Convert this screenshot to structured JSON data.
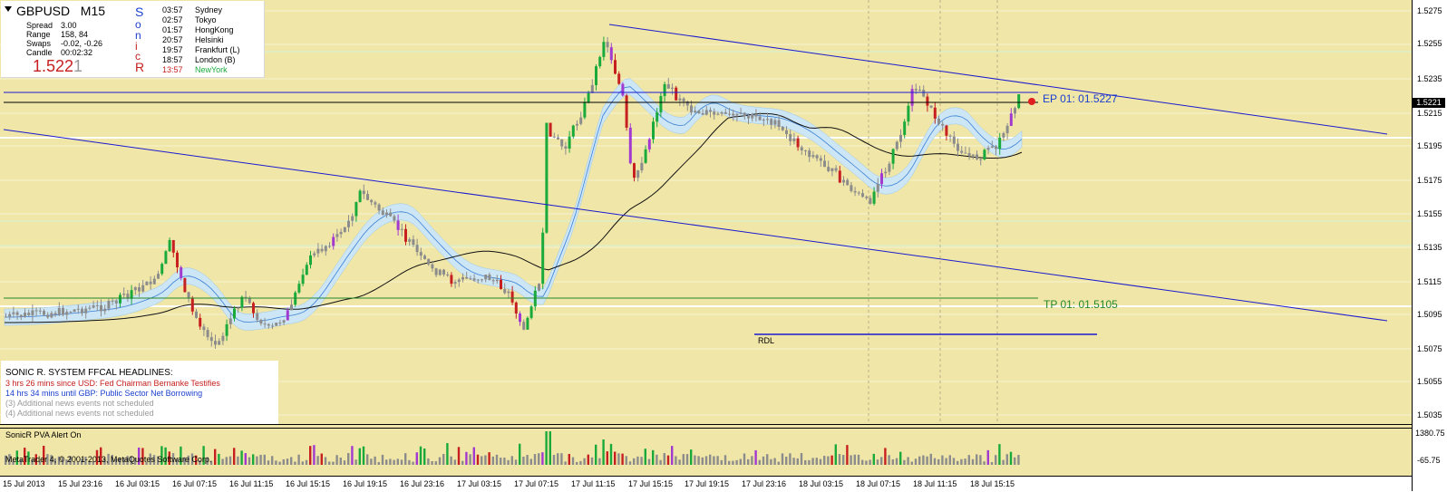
{
  "symbol": {
    "name": "GBPUSD",
    "timeframe": "M15"
  },
  "info": [
    {
      "label": "Spread",
      "value": "3.00"
    },
    {
      "label": "Range",
      "value": "158, 84"
    },
    {
      "label": "Swaps",
      "value": "-0.02, -0.26"
    },
    {
      "label": "Candle",
      "value": "00:02:32"
    }
  ],
  "price_big": {
    "main": "1.522",
    "last": "1"
  },
  "sonic_letters": [
    "S",
    "o",
    "n",
    "i",
    "c",
    "R"
  ],
  "sessions": [
    {
      "time": "03:57",
      "name": "Sydney"
    },
    {
      "time": "02:57",
      "name": "Tokyo"
    },
    {
      "time": "01:57",
      "name": "HongKong"
    },
    {
      "time": "20:57",
      "name": "Helsinki"
    },
    {
      "time": "19:57",
      "name": "Frankfurt  (L)"
    },
    {
      "time": "18:57",
      "name": "London  (B)"
    },
    {
      "time": "13:57",
      "name": "NewYork"
    }
  ],
  "news": {
    "title": "SONIC R. SYSTEM  FFCAL HEADLINES:",
    "lines": [
      "3 hrs 26 mins since USD: Fed Chairman Bernanke Testifies",
      "14 hrs 34 mins until GBP: Public Sector Net Borrowing",
      "(3)  Additional news events not scheduled",
      "(4)  Additional news events not scheduled"
    ]
  },
  "labels": {
    "ep": "EP 01:  01.5227",
    "tp": "TP 01:  01.5105",
    "rdl": "RDL",
    "volume": "SonicR PVA    Alert On",
    "copyright": "MetaTrader 4, © 2001-2013, MetaQuotes Software Corp."
  },
  "current_price": "1.5221",
  "price_axis": [
    "1.5275",
    "1.5255",
    "1.5235",
    "1.5215",
    "1.5195",
    "1.5175",
    "1.5155",
    "1.5135",
    "1.5115",
    "1.5095",
    "1.5075",
    "1.5055",
    "1.5035"
  ],
  "volume_axis": [
    "1380.75",
    "-65.75"
  ],
  "time_axis": [
    "15 Jul 2013",
    "15 Jul 23:16",
    "16 Jul 03:15",
    "16 Jul 07:15",
    "16 Jul 11:15",
    "16 Jul 15:15",
    "16 Jul 19:15",
    "16 Jul 23:16",
    "17 Jul 03:15",
    "17 Jul 07:15",
    "17 Jul 11:15",
    "17 Jul 15:15",
    "17 Jul 19:15",
    "17 Jul 23:16",
    "18 Jul 03:15",
    "18 Jul 07:15",
    "18 Jul 11:15",
    "18 Jul 15:15"
  ],
  "colors": {
    "background": "#f0e6a8",
    "bull": "#1aaa3c",
    "bear": "#c62020",
    "neutral": "#8c8c8c",
    "climax": "#a23ad0",
    "channel": "#1a1acf",
    "tp_line": "#22882a",
    "dragon": "#cde6f5"
  }
}
